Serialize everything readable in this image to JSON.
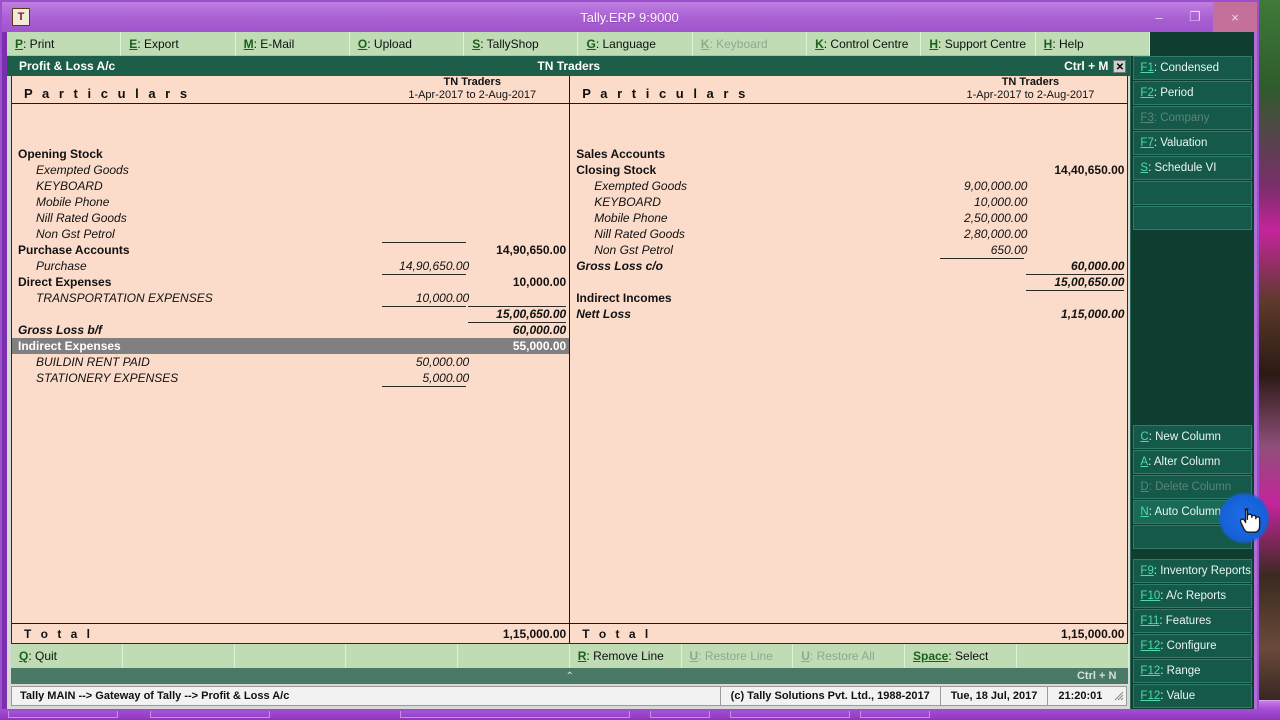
{
  "window": {
    "title": "Tally.ERP 9:9000",
    "app_icon": "tally-icon",
    "minimize": "–",
    "maximize": "❐",
    "close": "×"
  },
  "toolbar": {
    "buttons": [
      {
        "key": "P",
        "label": "Print",
        "disabled": false
      },
      {
        "key": "E",
        "label": "Export",
        "disabled": false
      },
      {
        "key": "M",
        "label": "E-Mail",
        "disabled": false
      },
      {
        "key": "O",
        "label": "Upload",
        "disabled": false
      },
      {
        "key": "S",
        "label": "TallyShop",
        "disabled": false
      },
      {
        "key": "G",
        "label": "Language",
        "disabled": false
      },
      {
        "key": "K",
        "label": "Keyboard",
        "disabled": true
      },
      {
        "key": "K",
        "label": "Control Centre",
        "disabled": false
      },
      {
        "key": "H",
        "label": "Support Centre",
        "disabled": false
      },
      {
        "key": "H",
        "label": "Help",
        "disabled": false
      }
    ]
  },
  "report_header": {
    "title": "Profit & Loss A/c",
    "company": "TN Traders",
    "shortcut": "Ctrl + M",
    "close_glyph": "✕"
  },
  "report": {
    "column_header": {
      "particulars": "P a r t i c u l a r s",
      "company": "TN Traders",
      "period": "1-Apr-2017 to 2-Aug-2017"
    },
    "left": {
      "rows": [
        {
          "label": "Opening Stock",
          "style": "group",
          "indent": false,
          "c1": "",
          "c2": ""
        },
        {
          "label": "Exempted Goods",
          "style": "italic",
          "indent": true,
          "c1": "",
          "c2": ""
        },
        {
          "label": "KEYBOARD",
          "style": "italic",
          "indent": true,
          "c1": "",
          "c2": ""
        },
        {
          "label": "Mobile Phone",
          "style": "italic",
          "indent": true,
          "c1": "",
          "c2": ""
        },
        {
          "label": "Nill Rated Goods",
          "style": "italic",
          "indent": true,
          "c1": "",
          "c2": ""
        },
        {
          "label": "Non Gst Petrol",
          "style": "italic",
          "indent": true,
          "c1": "",
          "c2": ""
        },
        {
          "label": "Purchase Accounts",
          "style": "group",
          "indent": false,
          "c1": "",
          "c2": "14,90,650.00"
        },
        {
          "label": "Purchase",
          "style": "italic",
          "indent": true,
          "c1": "14,90,650.00",
          "c2": ""
        },
        {
          "label": "Direct Expenses",
          "style": "group",
          "indent": false,
          "c1": "",
          "c2": "10,000.00"
        },
        {
          "label": "TRANSPORTATION EXPENSES",
          "style": "italic",
          "indent": true,
          "c1": "10,000.00",
          "c2": ""
        },
        {
          "label": "",
          "style": "plain",
          "indent": false,
          "c1": "",
          "c2": "15,00,650.00"
        },
        {
          "label": "Gross Loss b/f",
          "style": "bolditalic",
          "indent": false,
          "c1": "",
          "c2": "60,000.00"
        },
        {
          "label": "Indirect Expenses",
          "style": "group",
          "indent": false,
          "c1": "",
          "c2": "55,000.00",
          "highlight": true
        },
        {
          "label": "BUILDIN RENT PAID",
          "style": "italic",
          "indent": true,
          "c1": "50,000.00",
          "c2": ""
        },
        {
          "label": "STATIONERY EXPENSES",
          "style": "italic",
          "indent": true,
          "c1": "5,000.00",
          "c2": ""
        }
      ],
      "total_label": "T o t a l",
      "total_amount": "1,15,000.00"
    },
    "right": {
      "rows": [
        {
          "label": "Sales Accounts",
          "style": "group",
          "indent": false,
          "c1": "",
          "c2": ""
        },
        {
          "label": "Closing Stock",
          "style": "group",
          "indent": false,
          "c1": "",
          "c2": "14,40,650.00"
        },
        {
          "label": "Exempted Goods",
          "style": "italic",
          "indent": true,
          "c1": "9,00,000.00",
          "c2": ""
        },
        {
          "label": "KEYBOARD",
          "style": "italic",
          "indent": true,
          "c1": "10,000.00",
          "c2": ""
        },
        {
          "label": "Mobile Phone",
          "style": "italic",
          "indent": true,
          "c1": "2,50,000.00",
          "c2": ""
        },
        {
          "label": "Nill Rated Goods",
          "style": "italic",
          "indent": true,
          "c1": "2,80,000.00",
          "c2": ""
        },
        {
          "label": "Non Gst Petrol",
          "style": "italic",
          "indent": true,
          "c1": "650.00",
          "c2": ""
        },
        {
          "label": "Gross Loss c/o",
          "style": "bolditalic",
          "indent": false,
          "c1": "",
          "c2": "60,000.00"
        },
        {
          "label": "",
          "style": "plain",
          "indent": false,
          "c1": "",
          "c2": "15,00,650.00"
        },
        {
          "label": "Indirect Incomes",
          "style": "group",
          "indent": false,
          "c1": "",
          "c2": ""
        },
        {
          "label": "Nett Loss",
          "style": "bolditalic",
          "indent": false,
          "c1": "",
          "c2": "1,15,000.00"
        }
      ],
      "total_label": "T o t a l",
      "total_amount": "1,15,000.00"
    }
  },
  "bottom_bar": {
    "buttons": [
      {
        "key": "Q",
        "label": "Quit",
        "disabled": false
      },
      {
        "key": "",
        "label": "",
        "disabled": false
      },
      {
        "key": "",
        "label": "",
        "disabled": false
      },
      {
        "key": "",
        "label": "",
        "disabled": false
      },
      {
        "key": "",
        "label": "",
        "disabled": false
      },
      {
        "key": "R",
        "label": "Remove Line",
        "disabled": false
      },
      {
        "key": "U",
        "label": "Restore Line",
        "disabled": true
      },
      {
        "key": "U",
        "label": "Restore All",
        "disabled": true
      },
      {
        "key": "Space",
        "label": "Select",
        "disabled": false
      },
      {
        "key": "",
        "label": "",
        "disabled": false
      }
    ],
    "ctrl_shortcut": "Ctrl + N",
    "chevron": "⌃"
  },
  "status_bar": {
    "path": "Tally MAIN --> Gateway of Tally --> Profit & Loss A/c",
    "copyright": "(c) Tally Solutions Pvt. Ltd., 1988-2017",
    "date": "Tue, 18 Jul, 2017",
    "time": "21:20:01"
  },
  "sidebar": {
    "top_items": [
      {
        "key": "F1",
        "label": "Condensed",
        "disabled": false
      },
      {
        "key": "F2",
        "label": "Period",
        "disabled": false
      },
      {
        "key": "F3",
        "label": "Company",
        "disabled": true
      },
      {
        "key": "F7",
        "label": "Valuation",
        "disabled": false
      },
      {
        "key": "S",
        "label": "Schedule VI",
        "disabled": false
      },
      {
        "key": "",
        "label": "",
        "disabled": false
      },
      {
        "key": "",
        "label": "",
        "disabled": false
      }
    ],
    "mid_items": [
      {
        "key": "C",
        "label": "New Column",
        "disabled": false
      },
      {
        "key": "A",
        "label": "Alter Column",
        "disabled": false
      },
      {
        "key": "D",
        "label": "Delete Column",
        "disabled": true
      },
      {
        "key": "N",
        "label": "Auto Column",
        "disabled": false,
        "hovered": true
      },
      {
        "key": "",
        "label": "",
        "disabled": false
      }
    ],
    "bottom_items": [
      {
        "key": "F9",
        "label": "Inventory Reports",
        "disabled": false
      },
      {
        "key": "F10",
        "label": "A/c Reports",
        "disabled": false
      },
      {
        "key": "F11",
        "label": "Features",
        "disabled": false
      },
      {
        "key": "F12",
        "label": "Configure",
        "disabled": false
      },
      {
        "key": "F12",
        "label": "Range",
        "disabled": false
      },
      {
        "key": "F12",
        "label": "Value",
        "disabled": false
      }
    ]
  },
  "colors": {
    "report_bg": "#fbdccb",
    "header_green": "#1c5e47",
    "sidebar_bg": "#0f3d30",
    "titlebar_purple": "#a95fd2",
    "highlight_row": "#808080",
    "click_highlight": "#1560d8"
  }
}
